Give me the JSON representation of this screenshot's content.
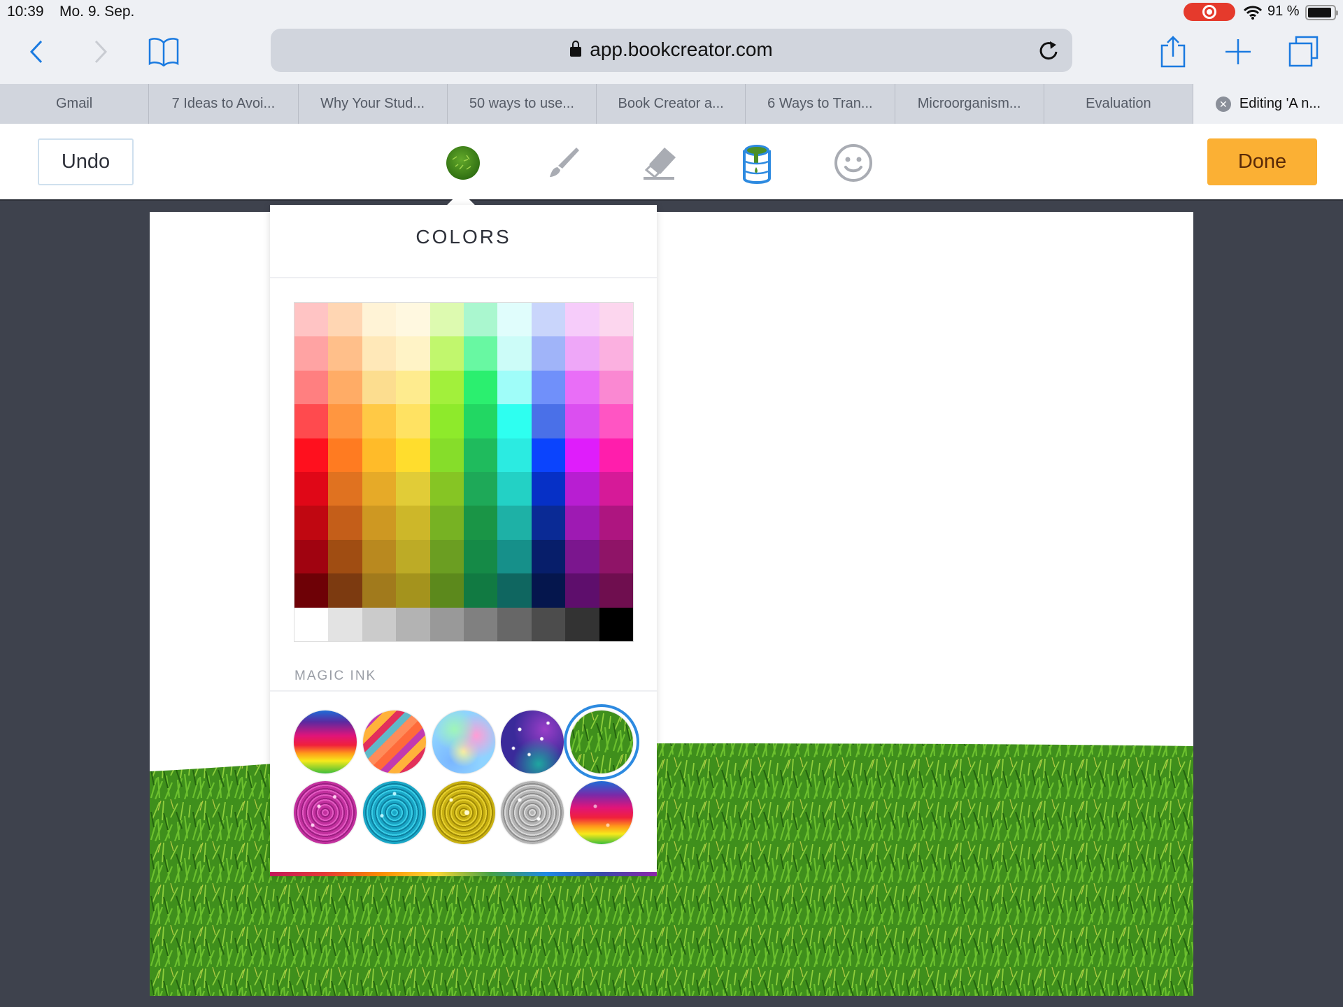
{
  "status_bar": {
    "time": "10:39",
    "date": "Mo. 9. Sep.",
    "battery_percent": "91 %",
    "battery_level": 0.91,
    "recording_active": true
  },
  "browser": {
    "url": "app.bookcreator.com",
    "icons": [
      "back-icon",
      "forward-icon",
      "bookmarks-icon",
      "lock-icon",
      "reload-icon",
      "share-icon",
      "new-tab-icon",
      "tabs-icon"
    ],
    "tabs": [
      {
        "label": "Gmail",
        "active": false
      },
      {
        "label": "7 Ideas to Avoi...",
        "active": false
      },
      {
        "label": "Why Your Stud...",
        "active": false
      },
      {
        "label": "50 ways to use...",
        "active": false
      },
      {
        "label": "Book Creator a...",
        "active": false
      },
      {
        "label": "6 Ways to Tran...",
        "active": false
      },
      {
        "label": "Microorganism...",
        "active": false
      },
      {
        "label": "Evaluation",
        "active": false
      },
      {
        "label": "Editing 'A n...",
        "active": true
      }
    ],
    "close_tab_glyph": "✕"
  },
  "toolbar": {
    "undo_label": "Undo",
    "done_label": "Done",
    "tools": [
      "color-picker",
      "pen",
      "eraser",
      "fill-bucket",
      "emoji"
    ],
    "selected_tool": "fill-bucket",
    "accent_color": "#fbb034",
    "selection_color": "#2d8ae0"
  },
  "popover": {
    "title": "COLORS",
    "magic_ink_label": "MAGIC INK",
    "palette_rows": [
      [
        "#ffc4c4",
        "#ffd6b3",
        "#fff3d6",
        "#fff8e0",
        "#ddfab0",
        "#aaf7cf",
        "#e0fdfc",
        "#c9d5fb",
        "#f6ccfa",
        "#fcd6ee"
      ],
      [
        "#ffa3a3",
        "#ffbf8a",
        "#ffe8b8",
        "#fff3c6",
        "#c1f76d",
        "#68f8a2",
        "#ccfcf8",
        "#a0b4f9",
        "#eea7f8",
        "#fbb0e0"
      ],
      [
        "#ff7f80",
        "#ffac66",
        "#fcdd8f",
        "#feeb8e",
        "#a2f03b",
        "#2bef6f",
        "#9ffdf9",
        "#7090fa",
        "#e96ef7",
        "#fa88d2"
      ],
      [
        "#ff4a4e",
        "#ff9640",
        "#ffc945",
        "#ffe262",
        "#8eea2b",
        "#22d763",
        "#2efff0",
        "#4a70e8",
        "#db4ff0",
        "#ff55c3"
      ],
      [
        "#ff101e",
        "#ff7b21",
        "#ffbb29",
        "#ffdd2d",
        "#86dd2a",
        "#1fbb5d",
        "#2bebe1",
        "#0b44fd",
        "#df1dfb",
        "#ff1eac"
      ],
      [
        "#e00717",
        "#e07220",
        "#e6aa28",
        "#e1cc37",
        "#86c524",
        "#1ea958",
        "#23d1c5",
        "#0630c6",
        "#b81ed2",
        "#d61a98"
      ],
      [
        "#c00711",
        "#c45e19",
        "#ce9822",
        "#cdb729",
        "#77b223",
        "#1a9546",
        "#1eb1a6",
        "#0a2a95",
        "#9e1ab3",
        "#ae1580"
      ],
      [
        "#a00310",
        "#a04d12",
        "#b9891f",
        "#bdab26",
        "#6b9e22",
        "#158a47",
        "#16908a",
        "#071e6a",
        "#7b168e",
        "#8f1467"
      ],
      [
        "#6e0106",
        "#7c3a10",
        "#a17a1c",
        "#a4931d",
        "#5c891c",
        "#117a42",
        "#0f6660",
        "#05164d",
        "#5e0e6c",
        "#6f0e4f"
      ],
      [
        "#ffffff",
        "#e3e3e3",
        "#cbcbcb",
        "#b3b3b3",
        "#999999",
        "#808080",
        "#676767",
        "#4c4c4c",
        "#333333",
        "#000000"
      ]
    ],
    "magic_inks": [
      {
        "name": "rainbow-gradient",
        "selected": false
      },
      {
        "name": "prism-stripes",
        "selected": false
      },
      {
        "name": "watercolor-pastel",
        "selected": false
      },
      {
        "name": "galaxy",
        "selected": false
      },
      {
        "name": "grass",
        "selected": true
      },
      {
        "name": "pink-glitter",
        "selected": false
      },
      {
        "name": "teal-glitter",
        "selected": false
      },
      {
        "name": "gold-glitter",
        "selected": false
      },
      {
        "name": "silver-glitter",
        "selected": false
      },
      {
        "name": "rainbow-glitter",
        "selected": false
      }
    ]
  }
}
